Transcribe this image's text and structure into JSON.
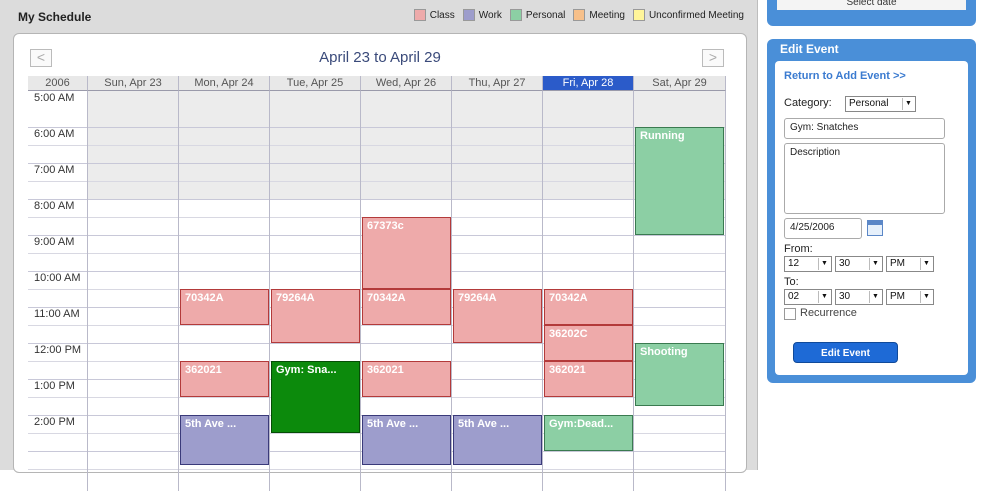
{
  "header": {
    "title": "My Schedule"
  },
  "legend": [
    {
      "label": "Class",
      "color": "#eeaaaa"
    },
    {
      "label": "Work",
      "color": "#9d9dcc"
    },
    {
      "label": "Personal",
      "color": "#8ccfa4"
    },
    {
      "label": "Meeting",
      "color": "#f7c08a"
    },
    {
      "label": "Unconfirmed Meeting",
      "color": "#fff59a"
    }
  ],
  "week": {
    "title": "April 23 to April 29",
    "prev": "<",
    "next": ">"
  },
  "columns": [
    "2006",
    "Sun, Apr 23",
    "Mon, Apr 24",
    "Tue, Apr 25",
    "Wed, Apr 26",
    "Thu, Apr 27",
    "Fri, Apr 28",
    "Sat, Apr 29"
  ],
  "times": [
    "5:00 AM",
    "6:00 AM",
    "7:00 AM",
    "8:00 AM",
    "9:00 AM",
    "10:00 AM",
    "11:00 AM",
    "12:00 PM",
    "1:00 PM",
    "2:00 PM"
  ],
  "events": [
    {
      "label": "Running",
      "type": "personal"
    },
    {
      "label": "67373c",
      "type": "class"
    },
    {
      "label": "70342A",
      "type": "class"
    },
    {
      "label": "79264A",
      "type": "class"
    },
    {
      "label": "70342A",
      "type": "class"
    },
    {
      "label": "79264A",
      "type": "class"
    },
    {
      "label": "70342A",
      "type": "class"
    },
    {
      "label": "36202C",
      "type": "class"
    },
    {
      "label": "Shooting",
      "type": "personal"
    },
    {
      "label": "362021",
      "type": "class"
    },
    {
      "label": "Gym: Sna...",
      "type": "gym"
    },
    {
      "label": "362021",
      "type": "class"
    },
    {
      "label": "362021",
      "type": "class"
    },
    {
      "label": "5th Ave ...",
      "type": "work"
    },
    {
      "label": "5th Ave ...",
      "type": "work"
    },
    {
      "label": "5th Ave ...",
      "type": "work"
    },
    {
      "label": "Gym:Dead...",
      "type": "personal"
    }
  ],
  "side": {
    "select_date": "Select date",
    "panel_title": "Edit Event",
    "return_link": "Return to Add Event >>",
    "category_label": "Category:",
    "category_value": "Personal",
    "title_value": "Gym: Snatches",
    "description": "Description",
    "date_value": "4/25/2006",
    "from_label": "From:",
    "from_hour": "12",
    "from_min": "30",
    "from_ampm": "PM",
    "to_label": "To:",
    "to_hour": "02",
    "to_min": "30",
    "to_ampm": "PM",
    "recurrence_label": "Recurrence",
    "edit_button": "Edit Event"
  }
}
